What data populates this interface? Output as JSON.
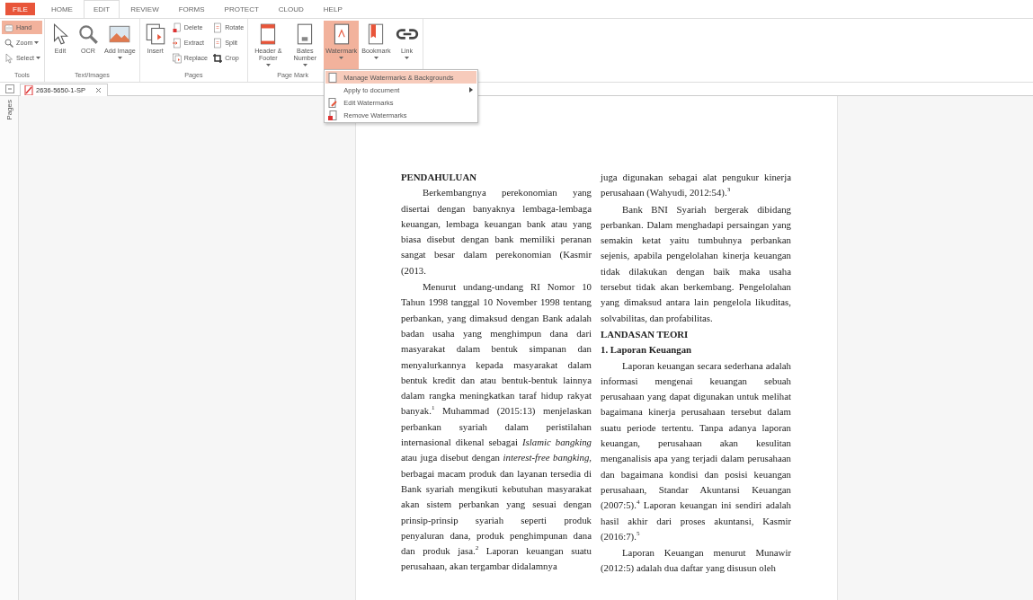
{
  "menu_tabs": [
    {
      "label": "FILE",
      "kind": "file",
      "selected": false
    },
    {
      "label": "HOME",
      "kind": "tab",
      "selected": false
    },
    {
      "label": "EDIT",
      "kind": "tab",
      "selected": true
    },
    {
      "label": "REVIEW",
      "kind": "tab",
      "selected": false
    },
    {
      "label": "FORMS",
      "kind": "tab",
      "selected": false
    },
    {
      "label": "PROTECT",
      "kind": "tab",
      "selected": false
    },
    {
      "label": "CLOUD",
      "kind": "tab",
      "selected": false
    },
    {
      "label": "HELP",
      "kind": "tab",
      "selected": false
    }
  ],
  "ribbon": {
    "groups": [
      {
        "label": "Tools",
        "columns": [
          [
            {
              "label": "Hand",
              "kind": "small",
              "dropdown": false,
              "selected": true
            },
            {
              "label": "Zoom",
              "kind": "small",
              "dropdown": true,
              "selected": false
            },
            {
              "label": "Select",
              "kind": "small",
              "dropdown": true,
              "selected": false
            }
          ]
        ]
      },
      {
        "label": "Text/Images",
        "columns": [
          [
            {
              "label": "Edit",
              "kind": "large",
              "dropdown": false,
              "selected": false
            }
          ],
          [
            {
              "label": "OCR",
              "kind": "large",
              "dropdown": false,
              "selected": false
            }
          ],
          [
            {
              "label": "Add Image",
              "kind": "large",
              "dropdown": true,
              "selected": false
            }
          ]
        ]
      },
      {
        "label": "Pages",
        "columns": [
          [
            {
              "label": "Insert",
              "kind": "large",
              "dropdown": false,
              "selected": false
            }
          ],
          [
            {
              "label": "Delete",
              "kind": "small",
              "dropdown": false,
              "selected": false
            },
            {
              "label": "Extract",
              "kind": "small",
              "dropdown": false,
              "selected": false
            },
            {
              "label": "Replace",
              "kind": "small",
              "dropdown": false,
              "selected": false
            }
          ],
          [
            {
              "label": "Rotate",
              "kind": "small",
              "dropdown": false,
              "selected": false
            },
            {
              "label": "Split",
              "kind": "small",
              "dropdown": false,
              "selected": false
            },
            {
              "label": "Crop",
              "kind": "small",
              "dropdown": false,
              "selected": false
            }
          ]
        ]
      },
      {
        "label": "Page Mark",
        "columns": [
          [
            {
              "label": "Header & Footer",
              "kind": "large",
              "dropdown": true,
              "selected": false
            }
          ],
          [
            {
              "label": "Bates Number",
              "kind": "large",
              "dropdown": true,
              "selected": false
            }
          ],
          [
            {
              "label": "Watermark",
              "kind": "large",
              "dropdown": true,
              "selected": true
            }
          ],
          [
            {
              "label": "Bookmark",
              "kind": "large",
              "dropdown": true,
              "selected": false
            }
          ],
          [
            {
              "label": "Link",
              "kind": "large",
              "dropdown": true,
              "selected": false
            }
          ]
        ]
      }
    ]
  },
  "dropdown_menu": {
    "items": [
      {
        "label": "Manage Watermarks & Backgrounds",
        "selected": true,
        "submenu": false
      },
      {
        "label": "Apply to document",
        "selected": false,
        "submenu": true
      },
      {
        "label": "Edit Watermarks",
        "selected": false,
        "submenu": false
      },
      {
        "label": "Remove Watermarks",
        "selected": false,
        "submenu": false
      }
    ]
  },
  "document_tab": {
    "title": "2636-5650-1-SP"
  },
  "sidebar": {
    "label": "Pages"
  },
  "document": {
    "columns": [
      [
        {
          "kind": "heading",
          "text": "PENDAHULUAN"
        },
        {
          "kind": "paragraph",
          "text": "Berkembangnya perekonomian yang disertai dengan banyaknya lembaga-lembaga keuangan, lembaga keuangan bank atau yang biasa disebut dengan bank memiliki peranan sangat besar dalam perekonomian (Kasmir (2013."
        },
        {
          "kind": "paragraph",
          "text": "Menurut undang-undang RI Nomor 10 Tahun 1998 tanggal 10 November 1998 tentang perbankan, yang dimaksud dengan Bank adalah badan usaha yang menghimpun dana dari masyarakat dalam bentuk simpanan dan menyalurkannya kepada masyarakat dalam bentuk kredit dan atau bentuk-bentuk lainnya dalam rangka meningkatkan taraf hidup rakyat banyak.$^{1}$ Muhammad (2015:13) menjelaskan perbankan syariah dalam peristilahan internasional dikenal sebagai *Islamic bangking* atau juga disebut dengan *interest-free bangking*, berbagai macam produk dan layanan tersedia di Bank syariah mengikuti kebutuhan masyarakat akan sistem perbankan yang sesuai dengan prinsip-prinsip syariah seperti produk penyaluran dana, produk penghimpunan dana dan produk jasa.$^{2}$ Laporan keuangan suatu perusahaan, akan tergambar didalamnya"
        }
      ],
      [
        {
          "kind": "continuation",
          "text": "juga digunakan sebagai alat pengukur kinerja perusahaan (Wahyudi, 2012:54).$^{3}$"
        },
        {
          "kind": "paragraph",
          "text": "Bank BNI Syariah bergerak dibidang perbankan. Dalam menghadapi persaingan yang semakin ketat yaitu tumbuhnya perbankan sejenis, apabila pengelolahan kinerja keuangan tidak dilakukan dengan baik maka usaha tersebut tidak akan berkembang. Pengelolahan yang dimaksud antara lain pengelola likuditas, solvabilitas, dan profabilitas."
        },
        {
          "kind": "heading",
          "text": "LANDASAN TEORI"
        },
        {
          "kind": "subheading",
          "text": "1. Laporan Keuangan"
        },
        {
          "kind": "paragraph",
          "text": "Laporan keuangan secara sederhana adalah informasi mengenai keuangan sebuah perusahaan yang dapat digunakan untuk melihat bagaimana kinerja perusahaan tersebut dalam suatu periode tertentu. Tanpa adanya laporan keuangan, perusahaan akan kesulitan menganalisis apa yang terjadi dalam perusahaan dan bagaimana kondisi dan posisi keuangan perusahaan, Standar Akuntansi Keuangan (2007:5).$^{4}$ Laporan keuangan ini sendiri adalah hasil akhir dari proses akuntansi, Kasmir (2016:7).$^{5}$"
        },
        {
          "kind": "paragraph",
          "text": "Laporan Keuangan menurut Munawir (2012:5) adalah dua daftar yang disusun oleh"
        }
      ]
    ]
  }
}
